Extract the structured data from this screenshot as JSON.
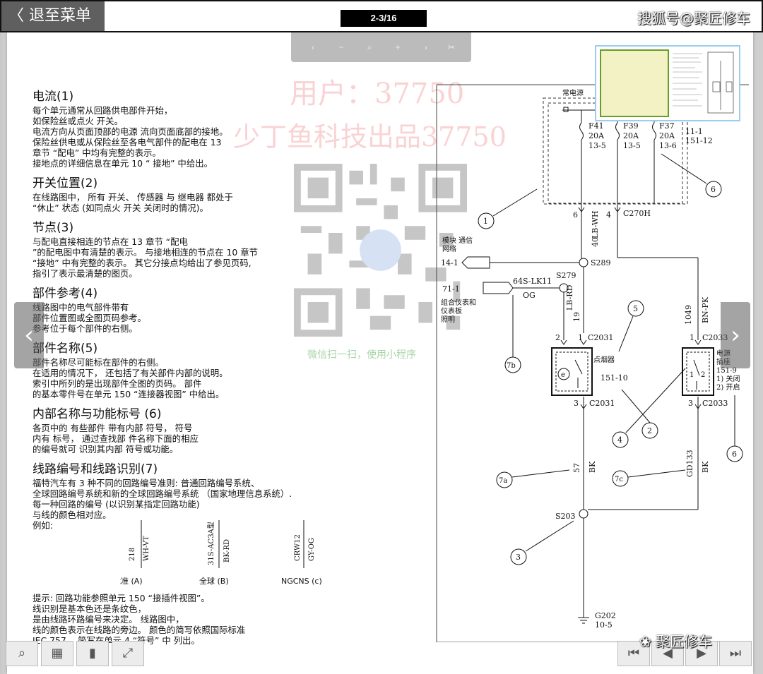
{
  "topbar": {
    "back_label": "退至菜单",
    "page": "2-3/16",
    "brand": "搜狐号@聚匠修车"
  },
  "watermark": {
    "line1": "用户：37750",
    "line2": "少丁鱼科技出品37750",
    "miniprogram": "微信扫一扫，使用小程序"
  },
  "sections": [
    {
      "title": "电流(1)",
      "lines": [
        "每个单元通常从回路供电部件开始，",
        "如保险丝或点火 开关。",
        "电流方向从页面顶部的电源 流向页面底部的接地。",
        "保险丝供电或从保险丝至各电气部件的配电在 13",
        "章节 “配电” 中均有完整的表示。",
        "接地点的详细信息在单元 10 “ 接地” 中给出。"
      ]
    },
    {
      "title": "开关位置(2)",
      "lines": [
        "在线路图中，  所有 开关、 传感器 与 继电器 都处于",
        "“休止” 状态 (如同点火 开关 关闭时的情况)。"
      ]
    },
    {
      "title": "节点(3)",
      "lines": [
        "与配电直接相连的节点在 13 章节 “配电",
        "”的配电图中有清楚的表示。 与接地相连的节点在 10 章节",
        "“接地” 中有完整的表示。 其它分接点均给出了参见页码,",
        "指引了表示最清楚的图页。"
      ]
    },
    {
      "title": "部件参考(4)",
      "lines": [
        "线路图中的电气部件带有",
        "部件位置图或全图页码参考。",
        "参考位于每个部件的右侧。"
      ]
    },
    {
      "title": "部件名称(5)",
      "lines": [
        "部件名称尽可能标在部件的右侧。",
        "在适用的情况下，  还包括了有关部件内部的说明。",
        "索引中所列的是出现部件全图的页码。 部件",
        "的基本零件号在单元 150 “连接器视图” 中给出。"
      ]
    },
    {
      "title": "内部名称与功能标号  (6)",
      "lines": [
        "各页中的 有些部件 带有内部 符号，  符号",
        "内有 标号，  通过查找部 件名称下面的相应",
        "的编号就可 识别其内部 符号或功能。"
      ]
    },
    {
      "title": "线路编号和线路识别(7)",
      "lines": [
        "福特汽车有 3 种不同的回路编号准则: 普通回路编号系统、",
        "全球回路编号系统和新的全球回路编号系统  （国家地理信息系统）.",
        "每一种回路的编号  (以识别某指定回路功能)",
        "与线的颜色相对应。",
        "例如:"
      ]
    }
  ],
  "examples": [
    {
      "code": "218",
      "color": "WH-VT",
      "label": "标准 (A)"
    },
    {
      "code": "31S-AC3A型",
      "color": "BK-RD",
      "label": "全球 (B)"
    },
    {
      "code": "CRW12",
      "color": "GY-OG",
      "label": "NGCNS  (c)"
    }
  ],
  "tips": [
    "提示:  回路功能参照单元 150 “接插件视图”。",
    "线识别是基本色还是条纹色，",
    "是由线路环路编号来决定。 线路图中，",
    "线的颜色表示在线路的旁边。 颜色的简写依照国际标准",
    "IEC 757。 简写在单元 4 “符号” 中 列出。"
  ],
  "diagram": {
    "power_label": "常电源",
    "fuses": [
      {
        "id": "F41",
        "amp": "20A",
        "ref": "13-5"
      },
      {
        "id": "F39",
        "amp": "20A",
        "ref": "13-5"
      },
      {
        "id": "F37",
        "amp": "20A",
        "ref": "13-6"
      }
    ],
    "fuse_ref_right": [
      "11-1",
      "151-12"
    ],
    "c270h": "C270H",
    "pin6": "6",
    "pin4": "4",
    "wire40": "40",
    "wire_lbwh": "LB-WH",
    "module_comm": [
      "模块 通信",
      "网络"
    ],
    "conn141": "14-1",
    "s289": "S289",
    "conn711": "71-1",
    "lk11": "64S-LK11",
    "og": "OG",
    "s279": "S279",
    "cluster": [
      "组合仪表和",
      "仪表板",
      "照明"
    ],
    "wire19": "19",
    "wire_lbrd": "LB-RD",
    "wire1049": "1049",
    "wire_bnpk": "BN-PK",
    "c2031": "C2031",
    "c2033": "C2033",
    "pin2": "2",
    "pin1": "1",
    "pin3": "3",
    "lighter_label": "点烟器",
    "lighter_ref": "151-10",
    "switch_label": [
      "电源",
      "插座",
      "151-9",
      "1) 关闭",
      "2) 开启"
    ],
    "wire57": "57",
    "wire_bk": "BK",
    "wire_gd133": "GD133",
    "s203": "S203",
    "g202": [
      "G202",
      "10-5"
    ],
    "callouts": [
      "1",
      "2",
      "3",
      "4",
      "5",
      "6",
      "7a",
      "7b",
      "7c"
    ]
  },
  "bottom": {
    "credit": "聚匠修车"
  },
  "icons": [
    "zoom-icon",
    "grid-icon",
    "bookmark-icon",
    "fullscreen-icon",
    "first-page-icon",
    "prev-page-icon",
    "next-page-icon",
    "last-page-icon"
  ]
}
